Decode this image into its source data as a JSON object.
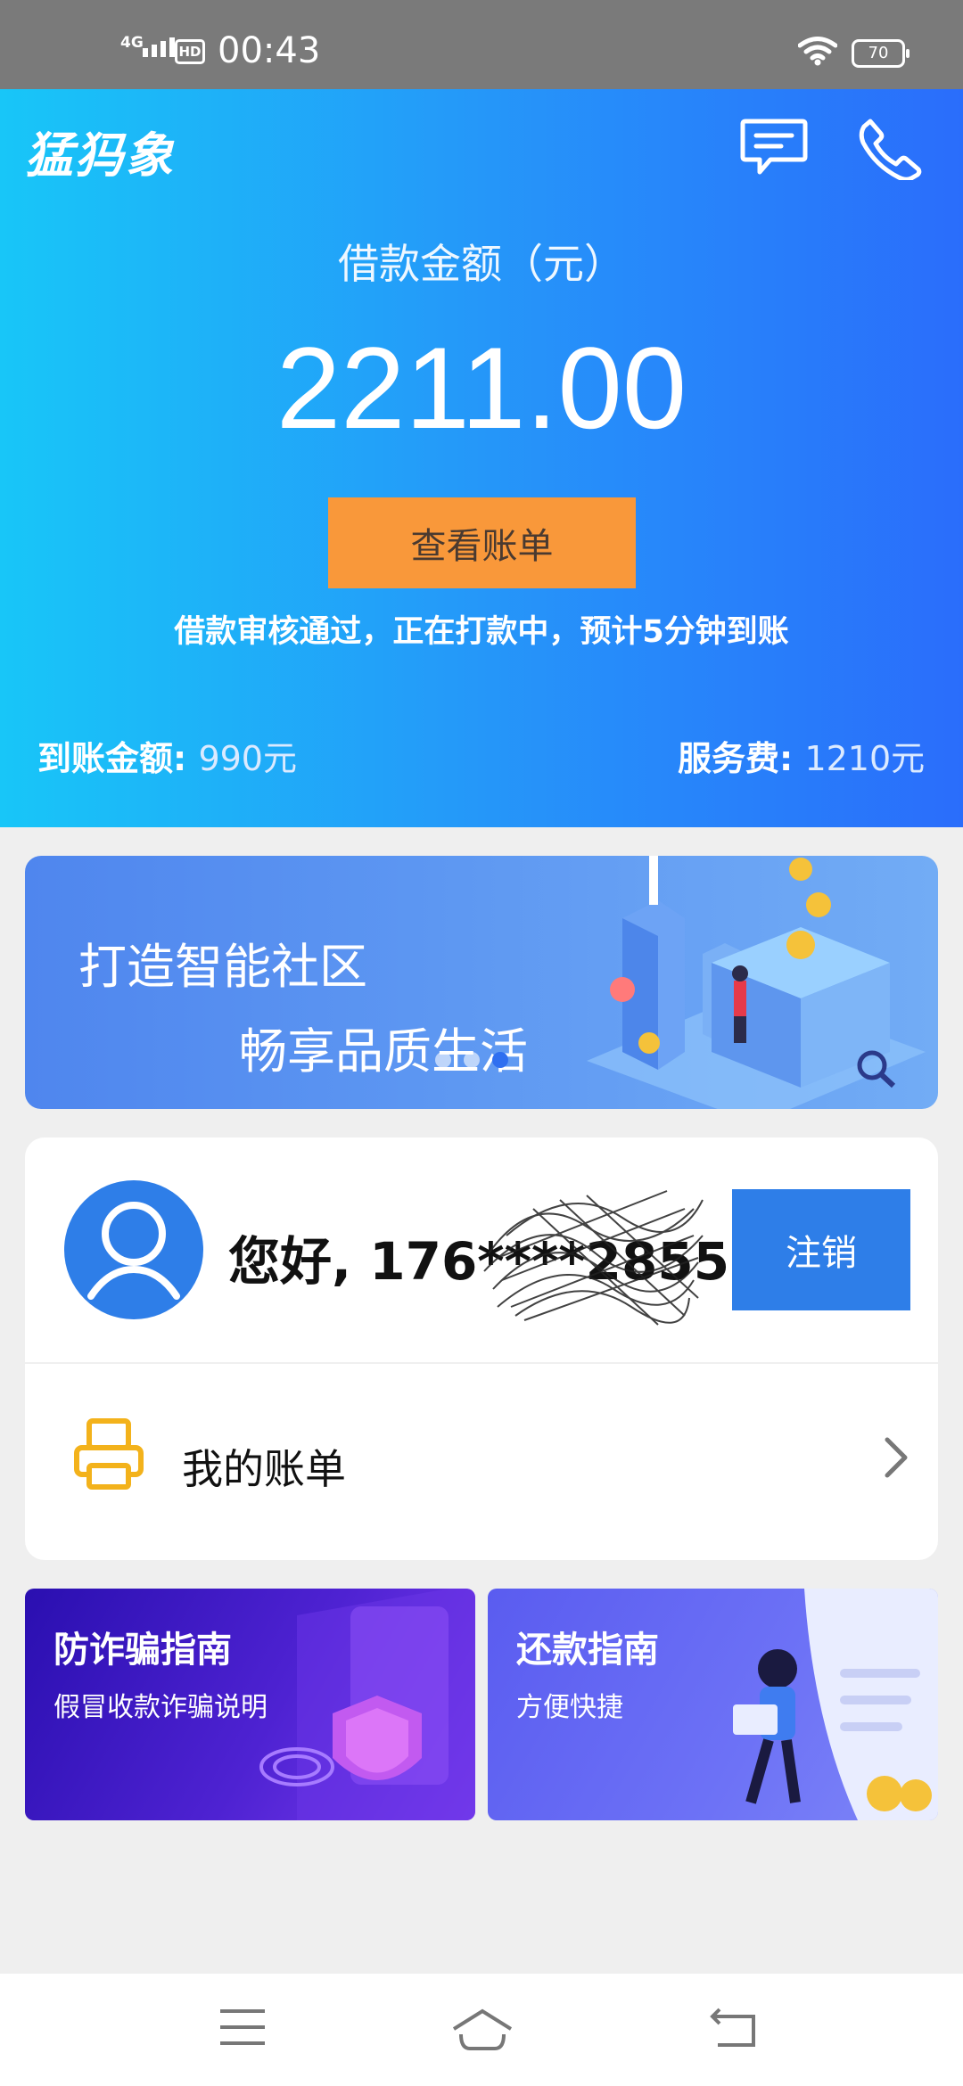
{
  "status_bar": {
    "network": "4G",
    "hd": "HD",
    "time": "00:43",
    "battery": "70"
  },
  "header": {
    "app_title": "猛犸象",
    "message_icon": "message-icon",
    "phone_icon": "phone-icon"
  },
  "loan": {
    "label": "借款金额（元）",
    "amount": "2211.00",
    "view_bill_label": "查看账单",
    "notice": "借款审核通过，正在打款中，预计5分钟到账",
    "received_label": "到账金额:",
    "received_value": "990元",
    "fee_label": "服务费:",
    "fee_value": "1210元"
  },
  "banner": {
    "line1": "打造智能社区",
    "line2": "畅享品质生活",
    "slide_count": 3,
    "active_slide": 3
  },
  "user": {
    "greeting": "您好, 176****2855",
    "logout_label": "注销",
    "bill_label": "我的账单"
  },
  "guides": [
    {
      "title": "防诈骗指南",
      "subtitle": "假冒收款诈骗说明"
    },
    {
      "title": "还款指南",
      "subtitle": "方便快捷"
    }
  ],
  "colors": {
    "hero_start": "#18c6f8",
    "hero_end": "#2a6dfb",
    "button_orange": "#f9983a",
    "logout_blue": "#2e7ee8"
  }
}
